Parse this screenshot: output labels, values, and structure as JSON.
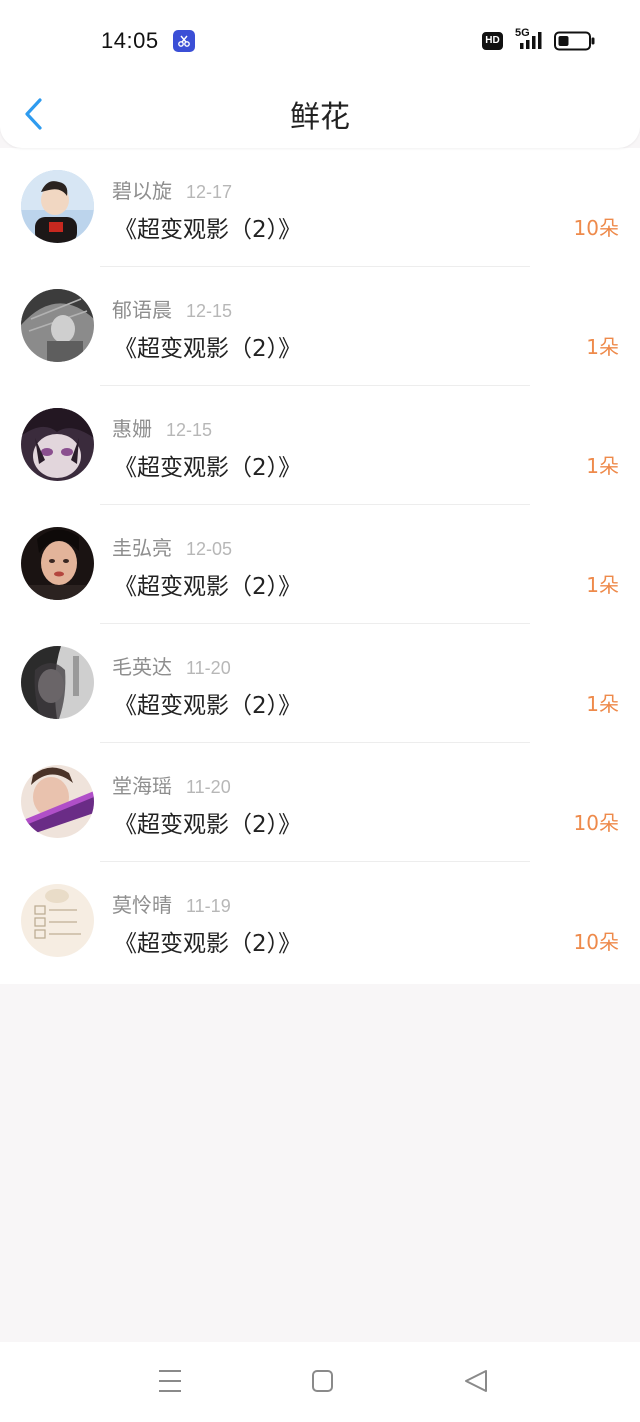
{
  "status_bar": {
    "time": "14:05",
    "hd": "HD",
    "network": "5G",
    "notification_icon": "scissors-app-icon"
  },
  "header": {
    "title": "鲜花",
    "back_icon": "chevron-left-icon"
  },
  "colors": {
    "accent_blue": "#2e9bef",
    "count_orange": "#ee8a4b",
    "name_gray": "#8e8e8e",
    "date_gray": "#b7b7b7"
  },
  "list": [
    {
      "name": "碧以旋",
      "date": "12-17",
      "title": "《超变观影（2）》",
      "count": "10朵"
    },
    {
      "name": "郁语晨",
      "date": "12-15",
      "title": "《超变观影（2）》",
      "count": "1朵"
    },
    {
      "name": "惠姗",
      "date": "12-15",
      "title": "《超变观影（2）》",
      "count": "1朵"
    },
    {
      "name": "圭弘亮",
      "date": "12-05",
      "title": "《超变观影（2）》",
      "count": "1朵"
    },
    {
      "name": "毛英达",
      "date": "11-20",
      "title": "《超变观影（2）》",
      "count": "1朵"
    },
    {
      "name": "堂海瑶",
      "date": "11-20",
      "title": "《超变观影（2）》",
      "count": "10朵"
    },
    {
      "name": "莫怜晴",
      "date": "11-19",
      "title": "《超变观影（2）》",
      "count": "10朵"
    }
  ],
  "nav_bar": {
    "menu_icon": "menu-icon",
    "home_icon": "home-square-icon",
    "back_icon": "back-triangle-icon"
  }
}
